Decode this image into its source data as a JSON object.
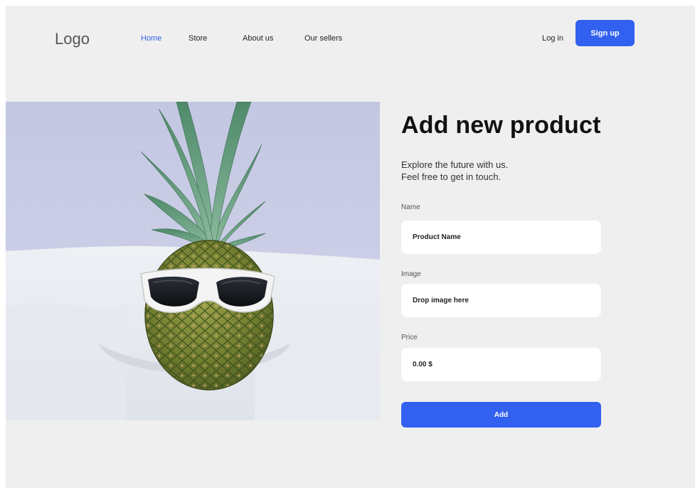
{
  "header": {
    "logo": "Logo",
    "nav": [
      {
        "label": "Home",
        "active": true
      },
      {
        "label": "Store",
        "active": false
      },
      {
        "label": "About us",
        "active": false
      },
      {
        "label": "Our sellers",
        "active": false
      }
    ],
    "login_label": "Log in",
    "signup_label": "Sign up"
  },
  "form": {
    "title": "Add new product",
    "subtitle_line1": "Explore the future with us.",
    "subtitle_line2": "Feel free to get in touch.",
    "name_label": "Name",
    "name_value": "Product Name",
    "image_label": "Image",
    "image_value": "Drop image here",
    "price_label": "Price",
    "price_value": "0.00 $",
    "add_label": "Add"
  },
  "colors": {
    "accent": "#3261f0",
    "background": "#efefef",
    "field": "#ffffff"
  }
}
